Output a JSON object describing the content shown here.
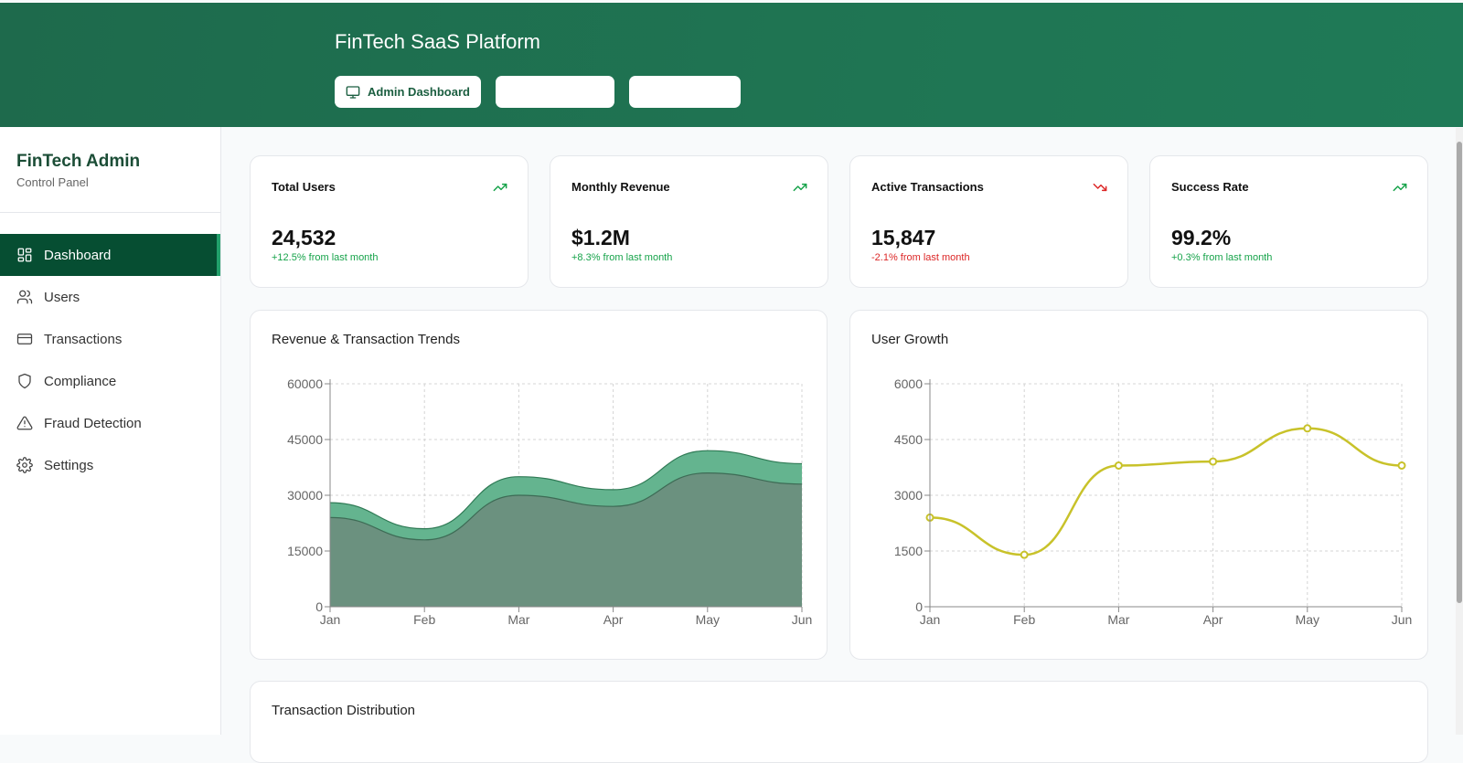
{
  "header": {
    "title": "FinTech SaaS Platform",
    "tabs": [
      {
        "label": "Admin Dashboard",
        "icon": "monitor-icon"
      },
      {
        "label": ""
      },
      {
        "label": ""
      }
    ]
  },
  "sidebar": {
    "brand_title": "FinTech Admin",
    "brand_subtitle": "Control Panel",
    "items": [
      {
        "label": "Dashboard",
        "icon": "dashboard-icon",
        "active": true
      },
      {
        "label": "Users",
        "icon": "users-icon"
      },
      {
        "label": "Transactions",
        "icon": "credit-card-icon"
      },
      {
        "label": "Compliance",
        "icon": "shield-icon"
      },
      {
        "label": "Fraud Detection",
        "icon": "alert-triangle-icon"
      },
      {
        "label": "Settings",
        "icon": "gear-icon"
      }
    ]
  },
  "stats": [
    {
      "title": "Total Users",
      "value": "24,532",
      "change": "+12.5% from last month",
      "trend": "up"
    },
    {
      "title": "Monthly Revenue",
      "value": "$1.2M",
      "change": "+8.3% from last month",
      "trend": "up"
    },
    {
      "title": "Active Transactions",
      "value": "15,847",
      "change": "-2.1% from last month",
      "trend": "down"
    },
    {
      "title": "Success Rate",
      "value": "99.2%",
      "change": "+0.3% from last month",
      "trend": "up"
    }
  ],
  "colors": {
    "up": "#16a34a",
    "down": "#dc2626",
    "area_top": "#64b48f",
    "area_bottom": "#6b917f",
    "line": "#c8c22a"
  },
  "distribution_title": "Transaction Distribution",
  "chart_data": [
    {
      "type": "area",
      "title": "Revenue & Transaction Trends",
      "categories": [
        "Jan",
        "Feb",
        "Mar",
        "Apr",
        "May",
        "Jun"
      ],
      "series": [
        {
          "values": [
            24000,
            18000,
            30000,
            27000,
            36000,
            33000
          ]
        },
        {
          "values": [
            28000,
            21000,
            35000,
            31500,
            42000,
            38500
          ]
        }
      ],
      "yticks": [
        0,
        15000,
        30000,
        45000,
        60000
      ],
      "ylim": [
        0,
        60000
      ],
      "grid": true
    },
    {
      "type": "line",
      "title": "User Growth",
      "categories": [
        "Jan",
        "Feb",
        "Mar",
        "Apr",
        "May",
        "Jun"
      ],
      "series": [
        {
          "values": [
            2400,
            1398,
            3800,
            3908,
            4800,
            3800
          ]
        }
      ],
      "yticks": [
        0,
        1500,
        3000,
        4500,
        6000
      ],
      "ylim": [
        0,
        6000
      ],
      "grid": true
    }
  ]
}
